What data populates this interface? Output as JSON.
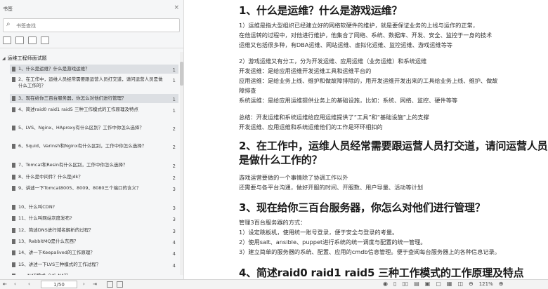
{
  "sidebar": {
    "title": "书签",
    "search_placeholder": "书签查找",
    "root": "运维工程师面试题",
    "items": [
      {
        "label": "1、什么是运维？什么是游戏运维？",
        "page": "1",
        "active": true
      },
      {
        "label": "2、在工作中，运维人员经常需要跟运营人员打交道，请问运营人员是做什么工作的？",
        "page": "1",
        "active": false
      },
      {
        "label": "3、现在给你三百台服务器，你怎么对他们进行管理？",
        "page": "1",
        "active": true
      },
      {
        "label": "4、简述raid0 raid1 raid5 三种工作模式的工作原理及特点",
        "page": "1",
        "active": false
      },
      {
        "label": "5、LVS、Nginx、HAproxy有什么区别？工作中你怎么选择？",
        "page": "2",
        "active": false
      },
      {
        "label": "6、Squid、Varinsh和Nginx有什么区别，工作中你怎么选择？",
        "page": "2",
        "active": false
      },
      {
        "label": "7、Tomcat和Resin有什么区别，工作中你怎么选择？",
        "page": "2",
        "active": false
      },
      {
        "label": "8、什么是中间件？什么是jdk？",
        "page": "2",
        "active": false
      },
      {
        "label": "9、讲述一下Tomcat8005、8009、8080三个端口的含义？",
        "page": "3",
        "active": false
      },
      {
        "label": "10、什么叫CDN?",
        "page": "3",
        "active": false
      },
      {
        "label": "11、什么叫网站灰度发布?",
        "page": "3",
        "active": false
      },
      {
        "label": "12、简述DNS进行域名解析的过程？",
        "page": "3",
        "active": false
      },
      {
        "label": "13、RabbitMQ是什么东西？",
        "page": "4",
        "active": false
      },
      {
        "label": "14、讲一下Keepalived的工作原理？",
        "page": "4",
        "active": false
      },
      {
        "label": "15、讲述一下LVS三种模式的工作过程？",
        "page": "4",
        "active": false
      },
      {
        "label": "一、NAT模式（VS-NAT）",
        "page": "4",
        "active": false
      }
    ]
  },
  "toolbar": {
    "page_indicator": "1/50",
    "zoom": "121%"
  },
  "document": {
    "h1": "1、什么是运维？什么是游戏运维？",
    "p1": [
      "1）运维是指大型组织已经建立好的网络软硬件的维护，就是要保证业务的上线与运作的正常，",
      "在他运转的过程中，对他进行维护，他集合了网络、系统、数据库、开发、安全、监控于一身的技术",
      "运维又包括很多种，有DBA运维、网站运维、虚拟化运维、监控运维、游戏运维等等"
    ],
    "p2": [
      "2）游戏运维又有分工，分为开发运维、应用运维（业务运维）和系统运维",
      "开发运维：是给应用运维开发运维工具和运维平台的",
      "应用运维：是给业务上线、维护和做故障排除的，用开发运维开发出来的工具给业务上线、维护、做故",
      "障排查",
      "系统运维：是给应用运维提供业务上的基础设施，比如：系统、网络、监控、硬件等等"
    ],
    "p3": [
      "总结：开发运维和系统运维给应用运维提供了“工具”和“基础设施”上的支撑",
      "开发运维、应用运维和系统运维他们的工作是环环相扣的"
    ],
    "h2a": "2、在工作中，运维人员经常需要跟运营人员打交道，请问运营人员",
    "h2b": "是做什么工作的？",
    "p4": [
      "游戏运营要做的一个事情除了协调工作以外",
      "还需要与各平台沟通，做好开服的时间、开服数、用户导量、活动等计划"
    ],
    "h3": "3、现在给你三百台服务器，你怎么对他们进行管理？",
    "p5": [
      "管理3百台服务器的方式：",
      "1）设定跳板机，使用统一账号登录，便于安全与登录的考量。",
      "2）使用salt、ansible、puppet进行系统的统一调度与配置的统一管理。",
      "3）建立简单的服务器的系统、配置、应用的cmdb信息管理。便于查阅每台服务器上的各种信息记录。"
    ],
    "h4": "4、简述raid0 raid1 raid5 三种工作模式的工作原理及特点"
  }
}
